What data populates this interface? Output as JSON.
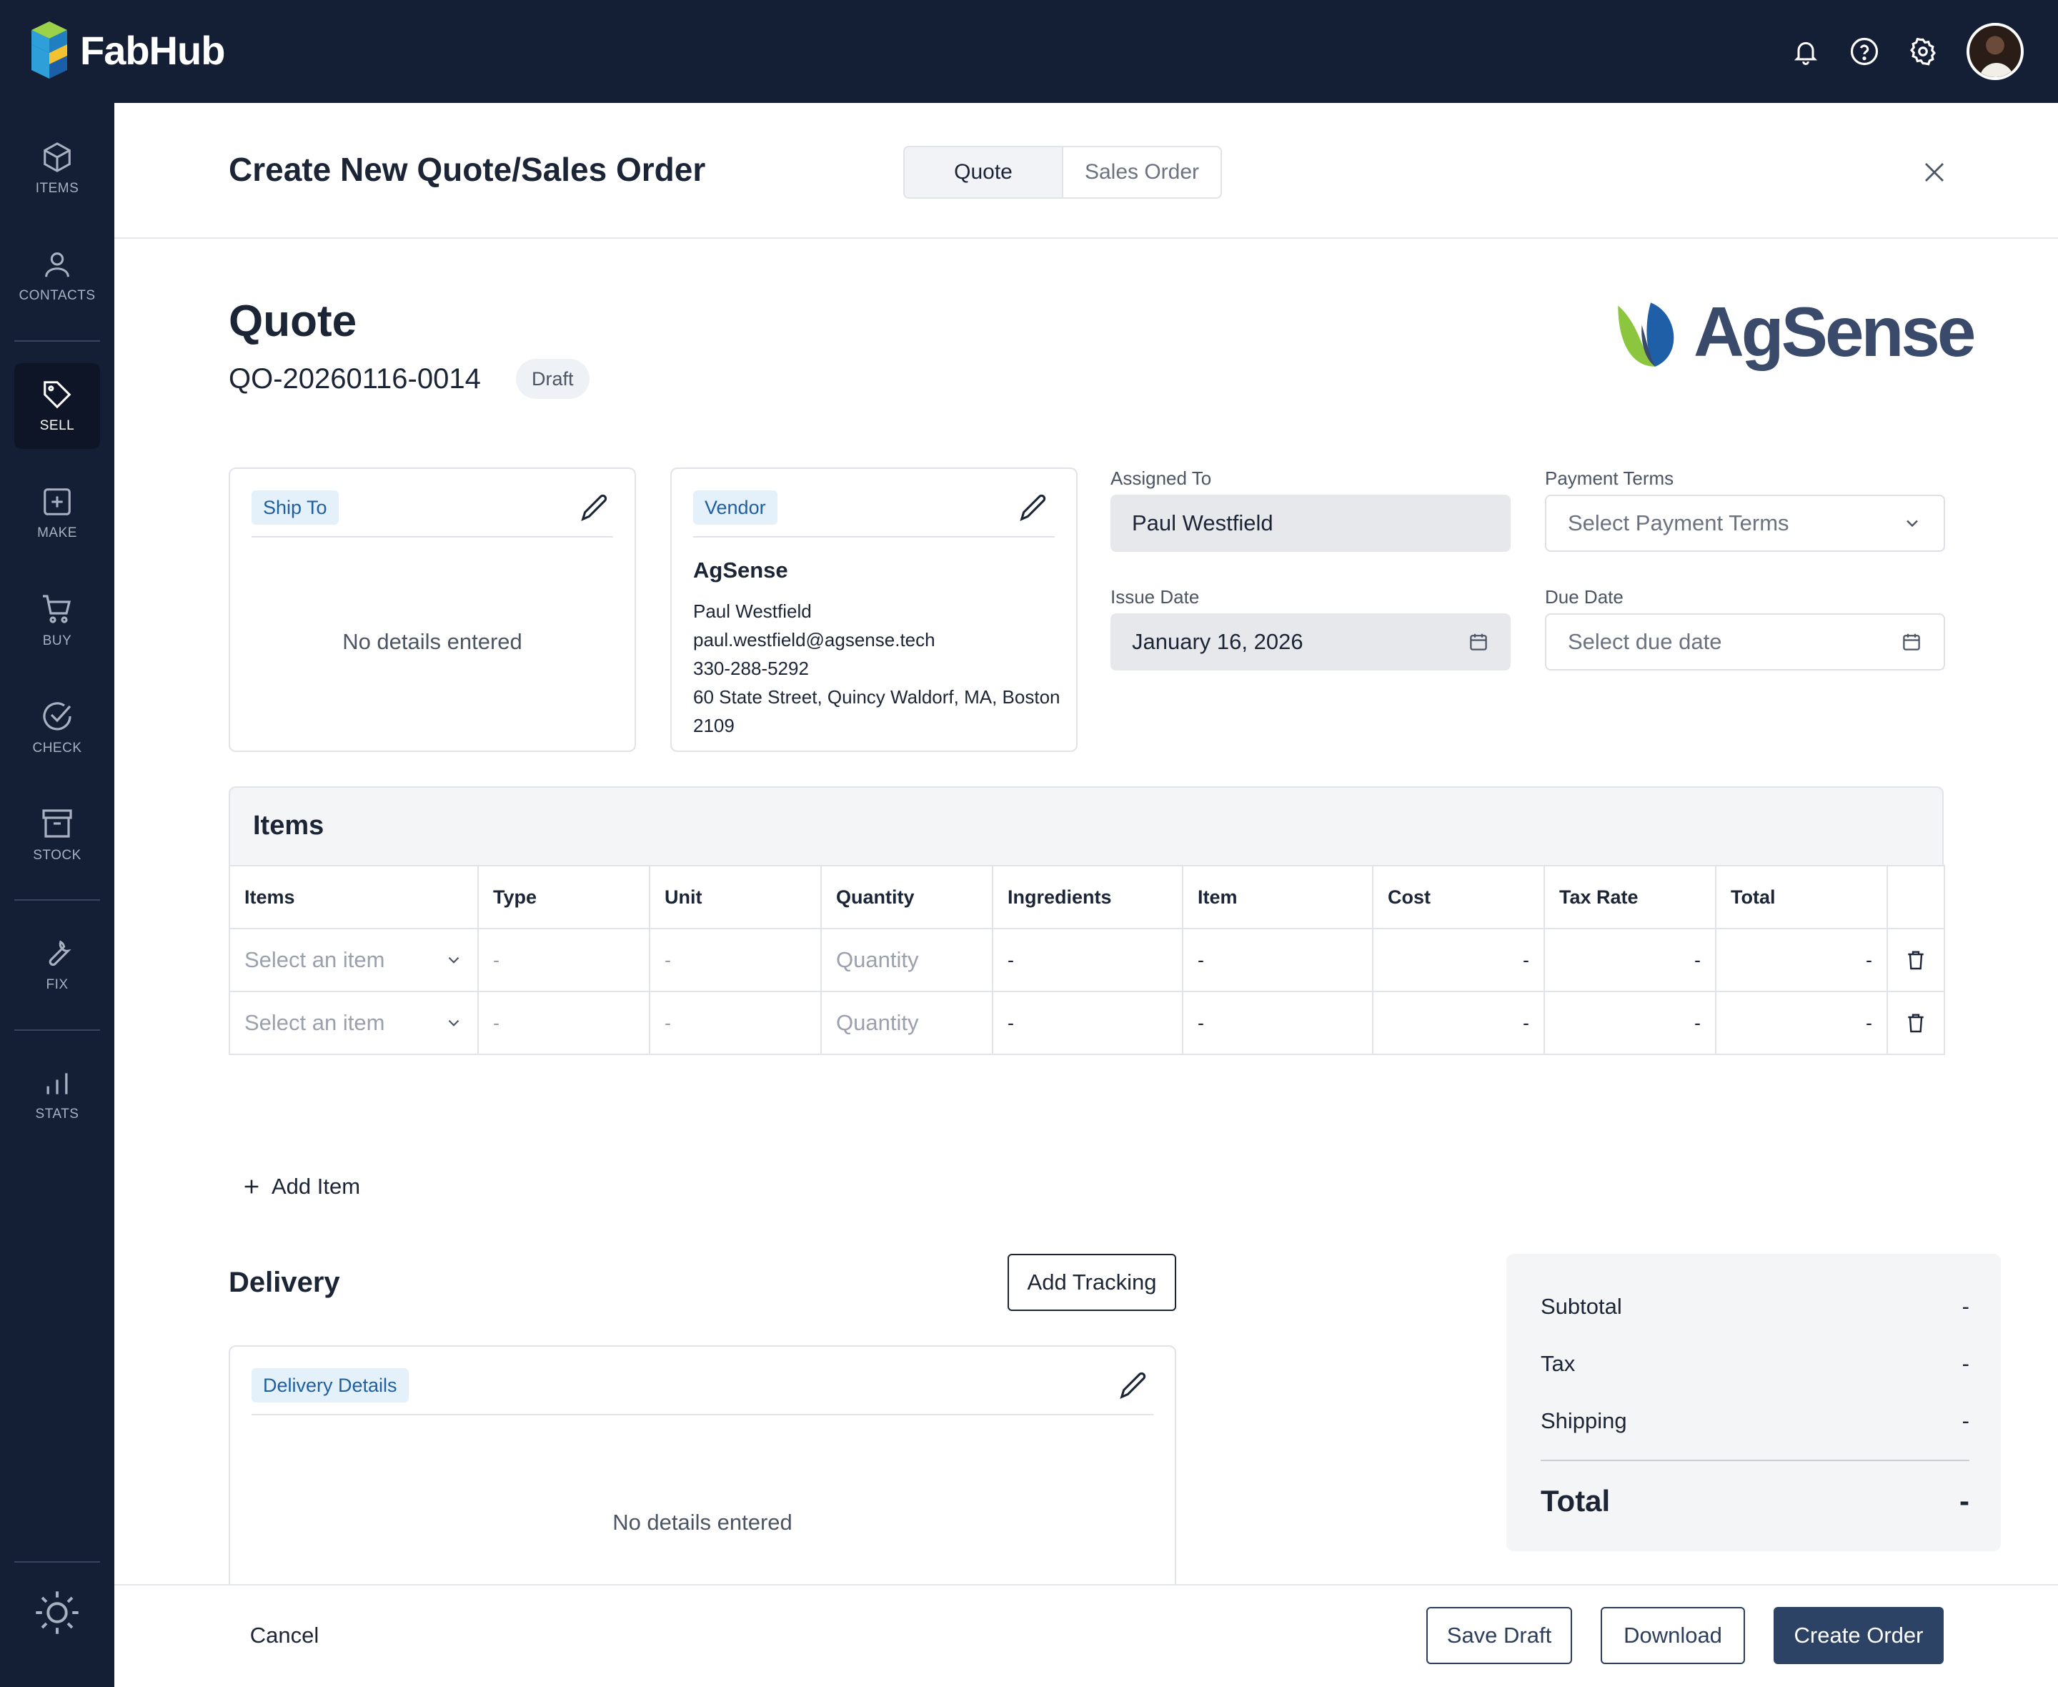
{
  "app": {
    "brand": "FabHub"
  },
  "topbar": {
    "icons": [
      "bell-icon",
      "help-icon",
      "gear-icon"
    ],
    "avatar": "user-avatar"
  },
  "sidebar": {
    "items": [
      {
        "label": "ITEMS",
        "icon": "cube-icon"
      },
      {
        "label": "CONTACTS",
        "icon": "person-icon"
      },
      {
        "label": "SELL",
        "icon": "tag-icon",
        "active": true
      },
      {
        "label": "MAKE",
        "icon": "plus-square-icon"
      },
      {
        "label": "BUY",
        "icon": "cart-icon"
      },
      {
        "label": "CHECK",
        "icon": "check-circle-icon"
      },
      {
        "label": "STOCK",
        "icon": "archive-icon"
      },
      {
        "label": "FIX",
        "icon": "wrench-icon"
      },
      {
        "label": "STATS",
        "icon": "bar-chart-icon"
      }
    ],
    "theme_icon": "sun-icon"
  },
  "header": {
    "title": "Create New Quote/Sales Order",
    "tabs": [
      {
        "label": "Quote",
        "active": true
      },
      {
        "label": "Sales Order",
        "active": false
      }
    ]
  },
  "document": {
    "type": "Quote",
    "number": "QO-20260116-0014",
    "status": "Draft",
    "logo_text": "AgSense"
  },
  "ship_to": {
    "tag": "Ship To",
    "empty": "No details entered"
  },
  "vendor": {
    "tag": "Vendor",
    "name": "AgSense",
    "contact": "Paul Westfield",
    "email": "paul.westfield@agsense.tech",
    "phone": "330-288-5292",
    "address_line1": "60 State Street, Quincy Waldorf, MA, Boston",
    "address_line2": "2109"
  },
  "fields": {
    "assigned_to": {
      "label": "Assigned To",
      "value": "Paul Westfield"
    },
    "payment_terms": {
      "label": "Payment Terms",
      "placeholder": "Select Payment Terms"
    },
    "issue_date": {
      "label": "Issue Date",
      "value": "January 16, 2026"
    },
    "due_date": {
      "label": "Due Date",
      "placeholder": "Select due date"
    }
  },
  "items": {
    "title": "Items",
    "columns": [
      "Items",
      "Type",
      "Unit",
      "Quantity",
      "Ingredients",
      "Item",
      "Cost",
      "Tax Rate",
      "Total"
    ],
    "rows": [
      {
        "item": "Select an item",
        "type": "-",
        "unit": "-",
        "quantity": "Quantity",
        "ingredients": "-",
        "item_col": "-",
        "cost": "-",
        "tax_rate": "-",
        "total": "-"
      },
      {
        "item": "Select an item",
        "type": "-",
        "unit": "-",
        "quantity": "Quantity",
        "ingredients": "-",
        "item_col": "-",
        "cost": "-",
        "tax_rate": "-",
        "total": "-"
      }
    ],
    "add_label": "Add Item"
  },
  "delivery": {
    "title": "Delivery",
    "add_tracking": "Add Tracking",
    "tag": "Delivery Details",
    "empty": "No details entered"
  },
  "summary": {
    "subtotal_label": "Subtotal",
    "subtotal": "-",
    "tax_label": "Tax",
    "tax": "-",
    "shipping_label": "Shipping",
    "shipping": "-",
    "total_label": "Total",
    "total": "-"
  },
  "footer": {
    "cancel": "Cancel",
    "save_draft": "Save Draft",
    "download": "Download",
    "create": "Create Order"
  },
  "colors": {
    "nav_bg": "#141e34",
    "primary": "#2c4366",
    "tag_bg": "#e4f1fb",
    "tag_text": "#1f5fa0"
  }
}
